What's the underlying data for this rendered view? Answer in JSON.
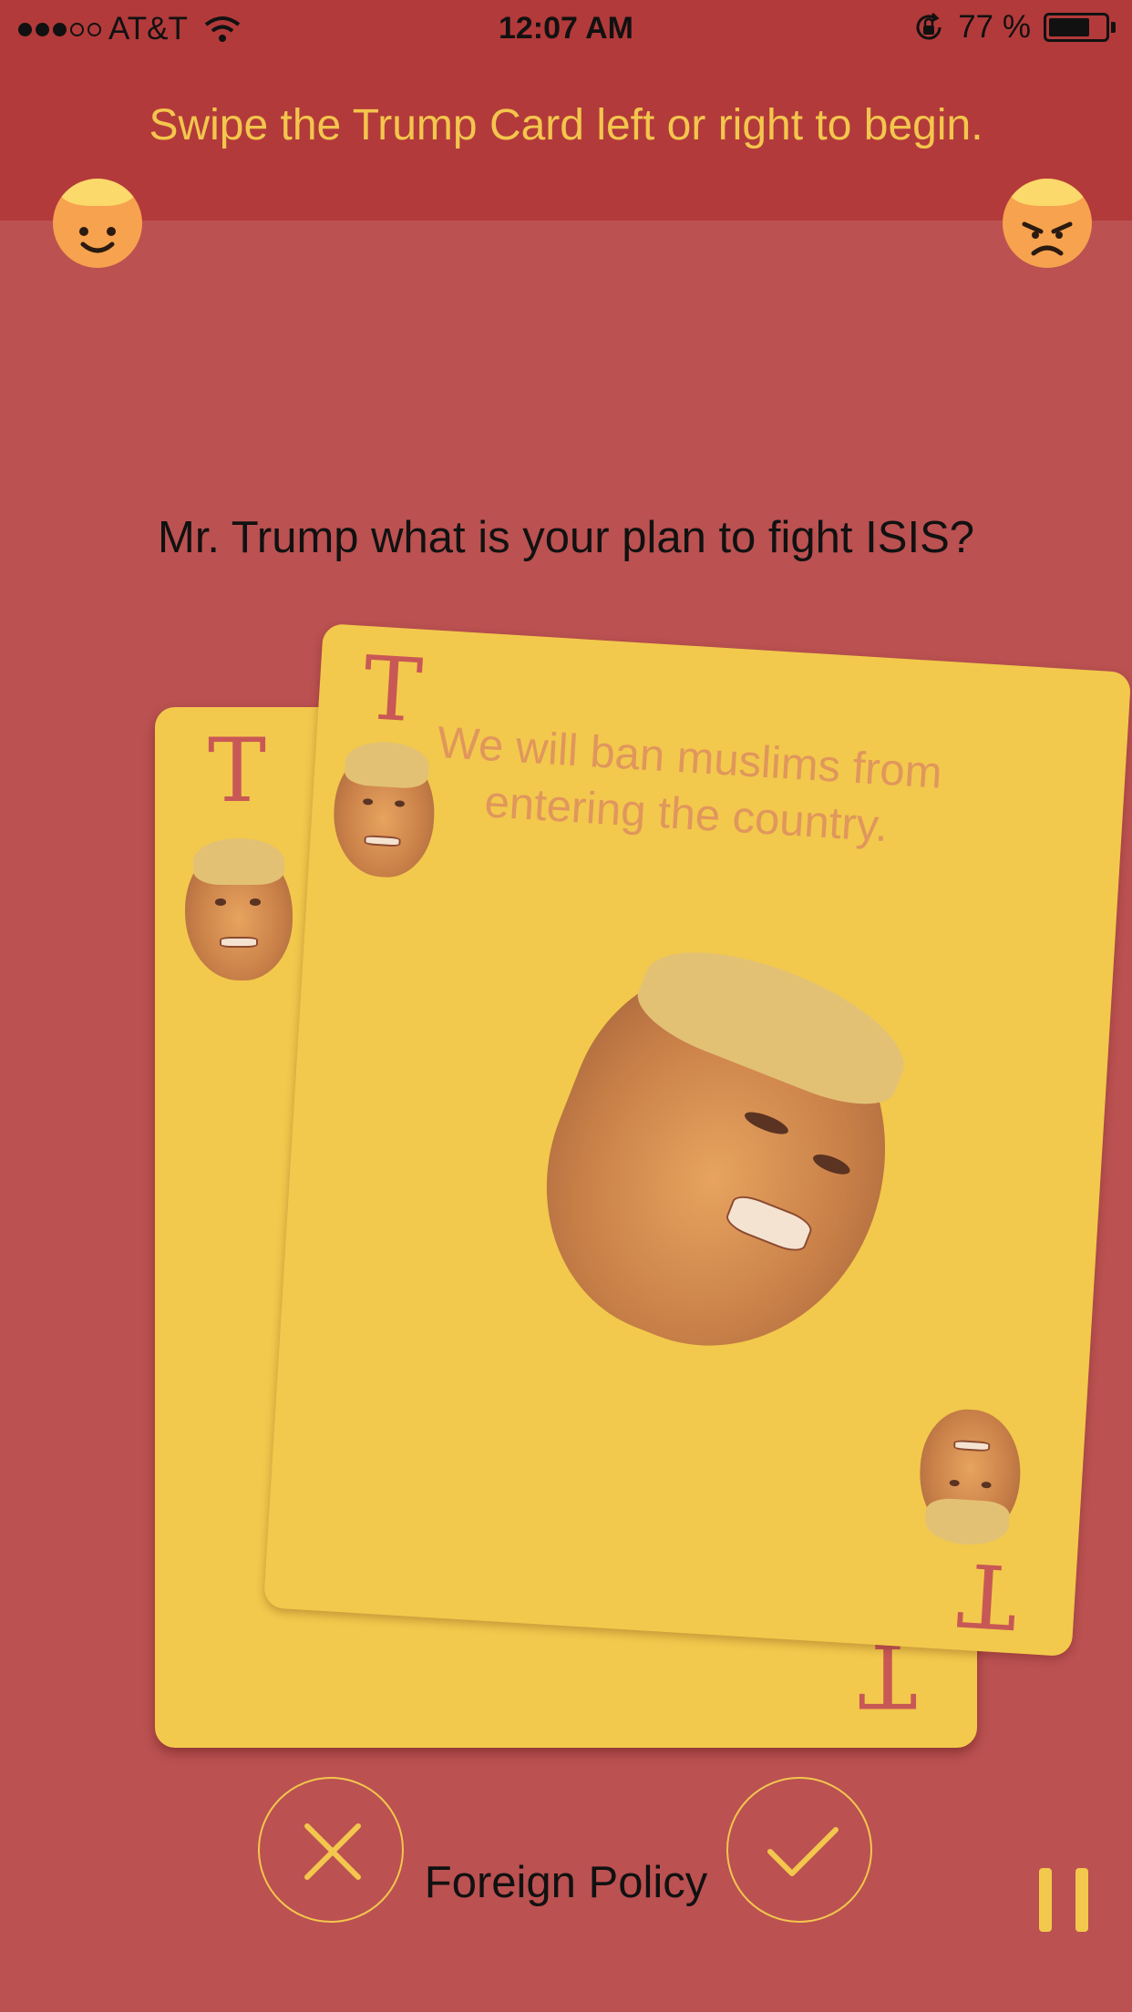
{
  "status_bar": {
    "carrier": "AT&T",
    "time": "12:07 AM",
    "battery": "77 %",
    "battery_level": 0.77,
    "signal_bars_filled": 3,
    "signal_bars_total": 5
  },
  "header": {
    "instruction": "Swipe the Trump Card left or right to begin.",
    "left_icon": "happy-face-icon",
    "right_icon": "angry-face-icon"
  },
  "question": "Mr. Trump what is your plan to fight ISIS?",
  "card": {
    "corner_letter": "T",
    "answer": "We will ban muslims from entering the country."
  },
  "back_card": {
    "corner_letter": "T"
  },
  "controls": {
    "reject_icon": "x-icon",
    "accept_icon": "checkmark-icon",
    "category": "Foreign Policy",
    "pause_icon": "pause-icon"
  },
  "colors": {
    "background": "#bb5151",
    "header": "#b33a3a",
    "accent": "#f3c64d",
    "card": "#f2c94c",
    "card_letter": "#c85856"
  }
}
